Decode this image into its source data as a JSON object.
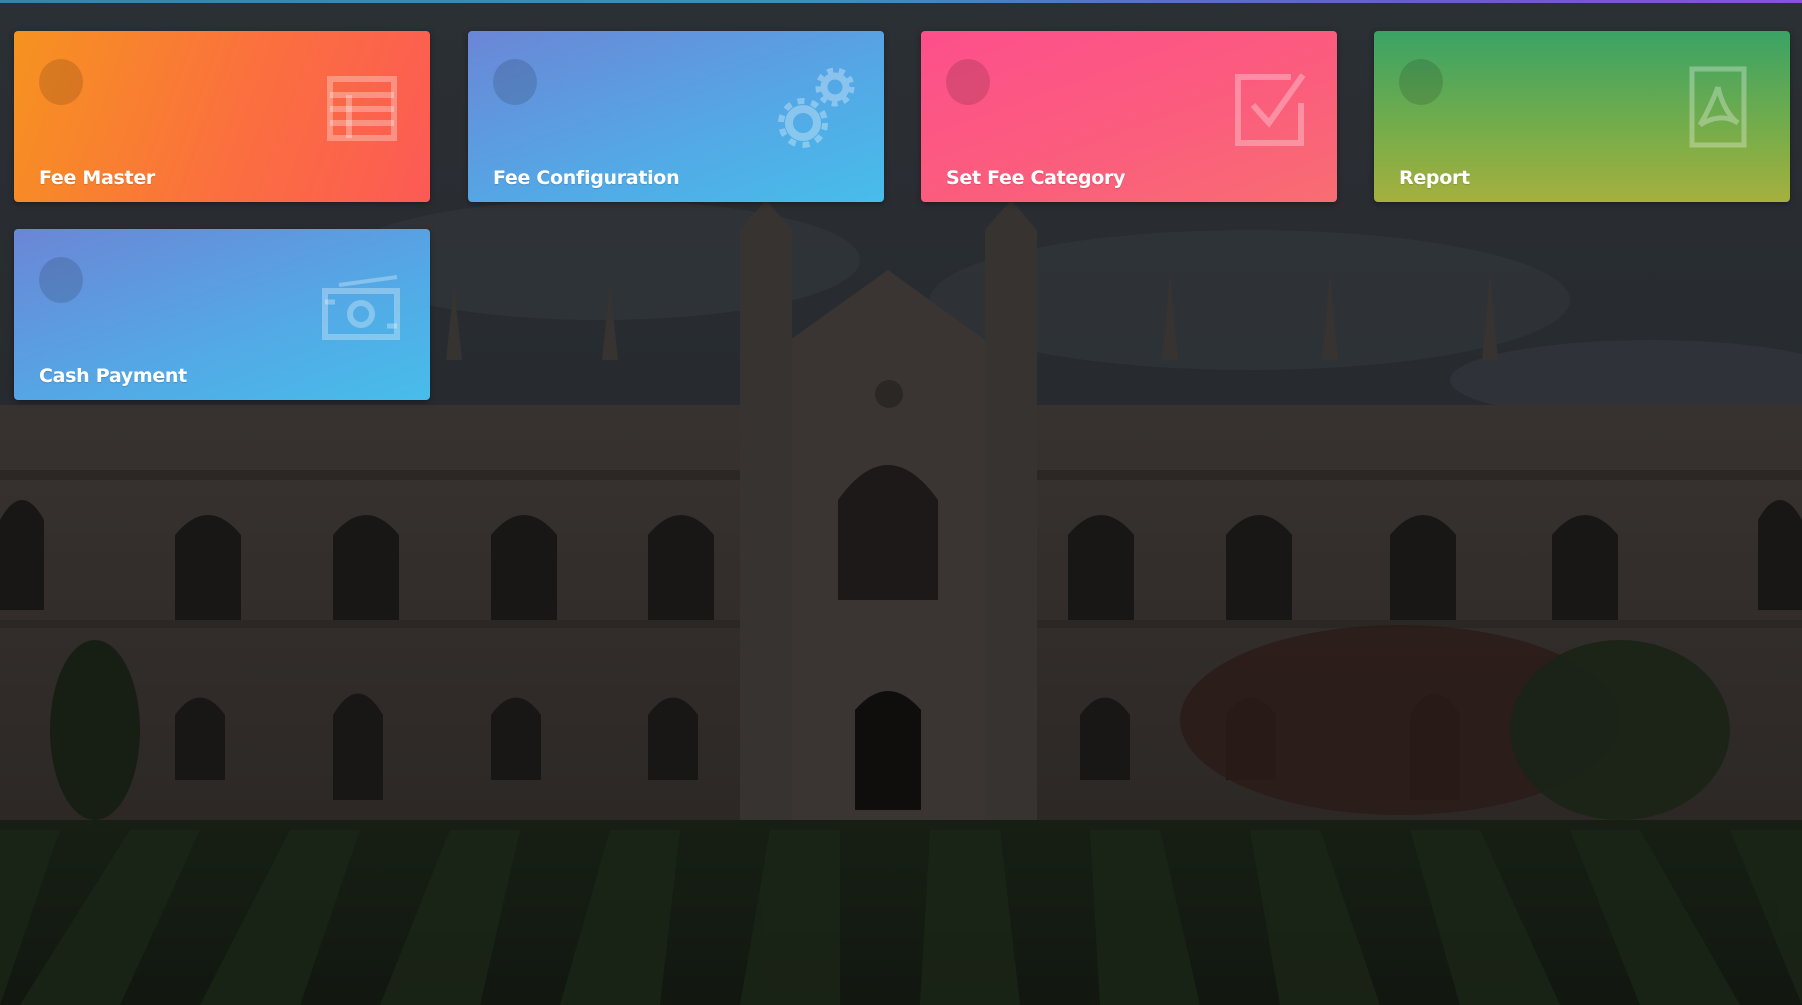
{
  "tiles": [
    {
      "label": "Fee Master",
      "icon": "table-icon"
    },
    {
      "label": "Fee Configuration",
      "icon": "gears-icon"
    },
    {
      "label": "Set Fee Category",
      "icon": "checkbox-icon"
    },
    {
      "label": "Report",
      "icon": "pdf-file-icon"
    },
    {
      "label": "Cash Payment",
      "icon": "money-icon"
    }
  ],
  "colors": {
    "fee_master": "#fb6f3f",
    "fee_configuration": "#53a9e6",
    "set_fee_category": "#fd4f8c",
    "report": "#78ad49",
    "cash_payment": "#53a9e6"
  }
}
